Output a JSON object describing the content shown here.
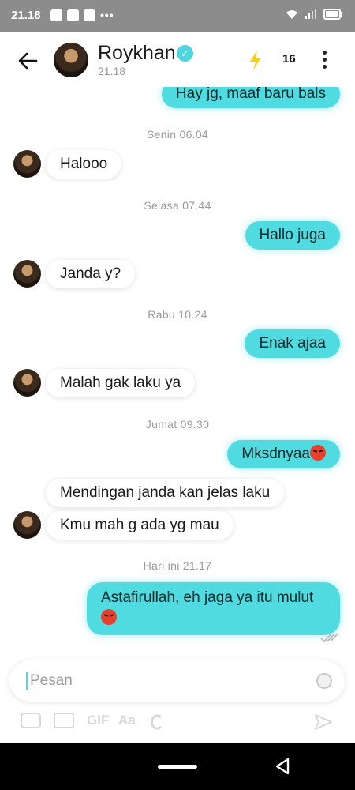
{
  "status_bar": {
    "time": "21.18"
  },
  "header": {
    "contact_name": "Roykhan",
    "last_seen": "21.18",
    "streak_count": "16"
  },
  "messages": [
    {
      "type": "out",
      "text": "Hay jg, maaf baru bals"
    },
    {
      "type": "date",
      "text": "Senin 06.04"
    },
    {
      "type": "in",
      "text": "Halooo"
    },
    {
      "type": "date",
      "text": "Selasa 07.44"
    },
    {
      "type": "out",
      "text": "Hallo juga"
    },
    {
      "type": "in",
      "text": "Janda y?"
    },
    {
      "type": "date",
      "text": "Rabu 10.24"
    },
    {
      "type": "out",
      "text": "Enak ajaa"
    },
    {
      "type": "in",
      "text": "Malah gak laku ya"
    },
    {
      "type": "date",
      "text": "Jumat 09.30"
    },
    {
      "type": "out",
      "text": "Mksdnyaa"
    },
    {
      "type": "in",
      "text": "Mendingan janda kan jelas laku"
    },
    {
      "type": "in",
      "text": "Kmu mah g ada yg mau"
    },
    {
      "type": "date",
      "text": "Hari ini 21.17"
    },
    {
      "type": "out",
      "text": "Astafirullah, eh jaga ya itu mulut"
    }
  ],
  "composer": {
    "placeholder": "Pesan"
  },
  "toolbar": {
    "gif_label": "GIF",
    "text_label": "Aa"
  },
  "colors": {
    "accent": "#4fdbe0",
    "status_bar": "#8c8c8c",
    "nav_bar": "#000000"
  }
}
